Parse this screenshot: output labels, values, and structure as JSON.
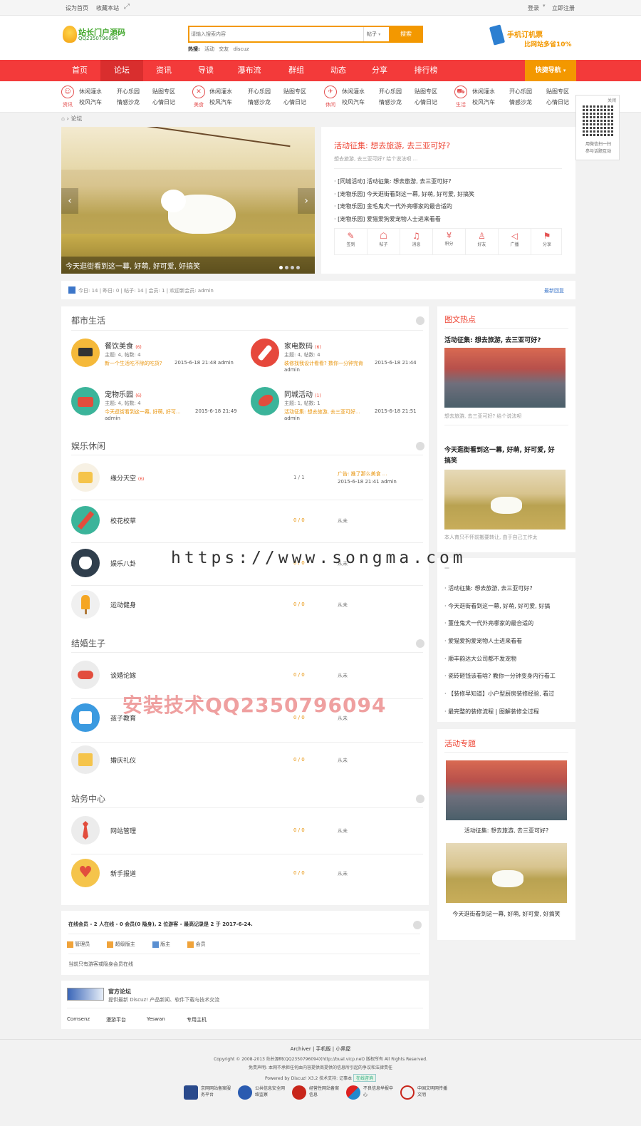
{
  "topbar": {
    "set_home": "设为首页",
    "bookmark": "收藏本站",
    "login": "登录",
    "register": "立即注册"
  },
  "header": {
    "logo_title": "站长门户源码",
    "logo_sub": "QQ2350796094",
    "search_placeholder": "请输入搜索内容",
    "search_type": "帖子",
    "search_button": "搜索",
    "hot_label": "热搜:",
    "hot_items": [
      "活动",
      "交友",
      "discuz"
    ],
    "ad_title": "手机订机票",
    "ad_sub": "比网站多省10%"
  },
  "nav": {
    "items": [
      "首页",
      "论坛",
      "资讯",
      "导读",
      "瀑布流",
      "群组",
      "动态",
      "分享",
      "排行榜"
    ],
    "quick_nav": "快捷导航"
  },
  "subnav": {
    "groups": [
      {
        "icon_label": "资讯",
        "links": [
          "休闲灌水",
          "开心乐园",
          "贴图专区",
          "校风汽车",
          "情感沙龙",
          "心情日记"
        ]
      },
      {
        "icon_label": "美食",
        "links": [
          "休闲灌水",
          "开心乐园",
          "贴图专区",
          "校风汽车",
          "情感沙龙",
          "心情日记"
        ]
      },
      {
        "icon_label": "休闲",
        "links": [
          "休闲灌水",
          "开心乐园",
          "贴图专区",
          "校风汽车",
          "情感沙龙",
          "心情日记"
        ]
      },
      {
        "icon_label": "生活",
        "links": [
          "休闲灌水",
          "开心乐园",
          "贴图专区",
          "校风汽车",
          "情感沙龙",
          "心情日记"
        ]
      }
    ]
  },
  "qr": {
    "close": "关闭",
    "text1": "用微信扫一扫",
    "text2": "参与话题互动"
  },
  "breadcrumb": {
    "current": "论坛"
  },
  "slider": {
    "caption": "今天逛街看到这一幕, 好萌, 好可爱, 好搞笑"
  },
  "feature": {
    "title": "活动征集: 想去旅游, 去三亚可好?",
    "desc": "想去旅游, 去三亚可好? 给个说法呗 ...",
    "list": [
      "[同城活动] 活动征集: 想去旅游, 去三亚可好?",
      "[宠物乐园] 今天逛街看到这一幕, 好萌, 好可爱, 好搞笑",
      "[宠物乐园] 金毛鬼犬一代外亮哪家的最合适的",
      "[宠物乐园] 爱猫爱狗爱宠物人士进来看看"
    ],
    "actions": [
      "签到",
      "帖子",
      "消息",
      "积分",
      "好友",
      "广播",
      "分享"
    ]
  },
  "stats": {
    "text": "今日: 14 | 昨日: 0 | 帖子: 14 | 会员: 1 | 欢迎新会员: admin",
    "latest": "最新回复"
  },
  "sections": [
    {
      "title": "都市生活"
    },
    {
      "title": "娱乐休闲"
    },
    {
      "title": "结婚生子"
    },
    {
      "title": "站务中心"
    }
  ],
  "city": [
    {
      "name": "餐饮美食",
      "badge": "(6)",
      "stats": "主题: 4, 帖数: 4",
      "last": "新一个生活吃不除的吃货?",
      "time": "2015-6-18 21:48 admin"
    },
    {
      "name": "家电数码",
      "badge": "(6)",
      "stats": "主题: 4, 帖数: 4",
      "last": "装修找我设计看看? 数你一分钟完肯",
      "time": "2015-6-18 21:44",
      "user": "admin"
    },
    {
      "name": "宠物乐园",
      "badge": "(6)",
      "stats": "主题: 4, 帖数: 4",
      "last": "今天逛街看到这一幕, 好萌, 好可...",
      "time": "2015-6-18 21:49",
      "user": "admin"
    },
    {
      "name": "同城活动",
      "badge": "(1)",
      "stats": "主题: 1, 帖数: 1",
      "last": "活动征集: 想去旅游, 去三亚可好...",
      "time": "2015-6-18 21:51",
      "user": "admin"
    }
  ],
  "fun": [
    {
      "name": "缘分天空",
      "badge": "(6)",
      "count": "1 / 1",
      "last": "广告: 推了那么美食 ...",
      "time": "2015-6-18 21:41 admin"
    },
    {
      "name": "校花校草",
      "count": "0 / 0",
      "last": "从未"
    },
    {
      "name": "娱乐八卦",
      "count": "0 / 0",
      "last": "从未"
    },
    {
      "name": "运动健身",
      "count": "0 / 0",
      "last": "从未"
    }
  ],
  "marry": [
    {
      "name": "谈婚论嫁",
      "count": "0 / 0",
      "last": "从未"
    },
    {
      "name": "孩子教育",
      "count": "0 / 0",
      "last": "从未"
    },
    {
      "name": "婚庆礼仪",
      "count": "0 / 0",
      "last": "从未"
    }
  ],
  "site": [
    {
      "name": "网站管理",
      "count": "0 / 0",
      "last": "从未"
    },
    {
      "name": "新手报道",
      "count": "0 / 0",
      "last": "从未"
    }
  ],
  "online": {
    "title": "在线会员 - 2 人在线 - 0 会员(0 隐身), 2 位游客 - 最高记录是 2 于 2017-6-24.",
    "legend": [
      "管理员",
      "超级版主",
      "版主",
      "会员"
    ],
    "note": "当前只有游客或隐身会员在线"
  },
  "links": {
    "title": "官方论坛",
    "desc": "提供最新 Discuz! 产品新闻、软件下载与技术交流",
    "items": [
      "Comsenz",
      "漫游平台",
      "Yeswan",
      "专用主机"
    ]
  },
  "right": {
    "hot_title": "图文热点",
    "post1_title": "活动征集: 想去旅游, 去三亚可好?",
    "post1_desc": "想去旅游, 去三亚可好? 给个说法呗",
    "post2_title": "今天逛街看到这一幕, 好萌, 好可爱, 好搞笑",
    "post2_desc": "本人育只不怀前搬要转让, 由于自己工作太",
    "list": [
      "活动征集: 想去旅游, 去三亚可好?",
      "今天逛街看到这一幕, 好萌, 好可爱, 好搞",
      "董佳鬼犬一代外亮哪家的最合适的",
      "爱猫爱狗爱宠物人士进来看看",
      "顺丰韵达大公司都不发宠物",
      "瓷砖砸钱该看啥? 教你一分钟变身内行看工",
      "【装修早知道】小户型厨房装修经验, 看过",
      "最完整的装修流程 | 图解装修全过程"
    ],
    "topic_title": "活动专题",
    "topic1": "活动征集: 想去旅游, 去三亚可好?",
    "topic2": "今天逛街看到这一幕, 好萌, 好可爱, 好搞笑"
  },
  "footer": {
    "links": [
      "Archiver",
      "手机版",
      "小黑屋"
    ],
    "copyright": "Copyright © 2008-2013 站长源码(QQ2350796094)(http://bual.vicp.net) 版权所有 All Rights Reserved.",
    "disclaimer": "免责声明: 本网不承担任何由内容提供商提供的信息所引起的争议和法律责任",
    "powered": "Powered by Discuz! X3.2  技术支持: 记事本",
    "online_btn": "在线咨询",
    "badges": [
      "京网网站备案服务平台",
      "公共信息安全网络监察",
      "经营性网站备案信息",
      "不良信息举报中心",
      "中国文明网传播文明"
    ]
  },
  "watermark": {
    "url": "https://www.songma.com",
    "qq": "安装技术QQ2350796094"
  },
  "colors": {
    "brand_red": "#f33a3a",
    "accent_orange": "#f39800",
    "link_red": "#e43"
  }
}
